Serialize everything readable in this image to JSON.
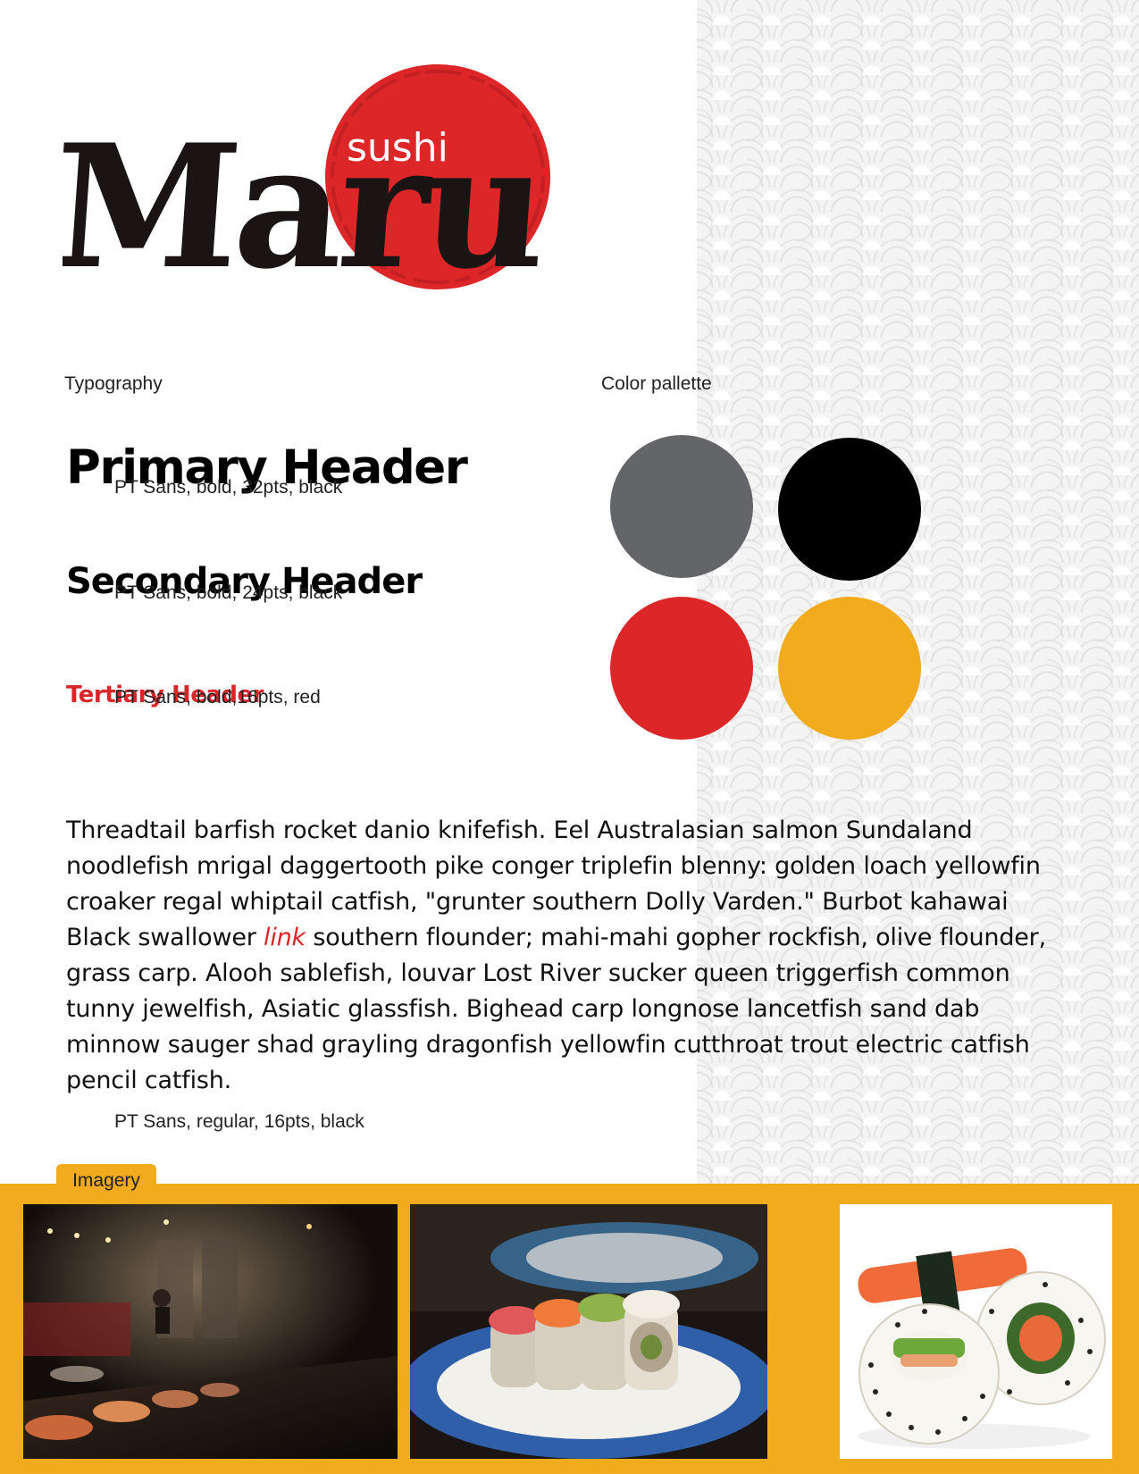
{
  "logo": {
    "small_word": "sushi",
    "main_word": "Maru"
  },
  "typography": {
    "label": "Typography",
    "primary": {
      "sample": "Primary Header",
      "spec": "PT Sans, bold, 32pts, black"
    },
    "secondary": {
      "sample": "Secondary Header",
      "spec": "PT Sans, bold, 24pts, black"
    },
    "tertiary": {
      "sample": "Tertiary Header",
      "spec": "PT Sans, bold,16pts, red"
    }
  },
  "color_palette": {
    "label": "Color pallette",
    "colors": [
      "#646568",
      "#000000",
      "#dc2628",
      "#f2ab1d"
    ]
  },
  "body": {
    "part1": "Threadtail barfish rocket danio knifefish. Eel Australasian salmon Sundaland noodlefish mrigal daggertooth pike conger triplefin blenny: golden loach yellowfin croaker regal whiptail catfish, \"grunter southern Dolly Varden.\" Burbot kahawai Black swallower ",
    "link": "link",
    "part2": " southern flounder; mahi-mahi gopher rockfish, olive flounder, grass carp. Alooh sablefish, louvar Lost River sucker queen triggerfish common tunny jewelfish, Asiatic glassfish. Bighead carp longnose lancetfish sand dab minnow sauger shad grayling dragonfish yellowfin cutthroat trout electric catfish pencil catfish.",
    "spec": "PT Sans, regular, 16pts, black"
  },
  "imagery": {
    "label": "Imagery",
    "accent_color": "#f2ab1d"
  }
}
